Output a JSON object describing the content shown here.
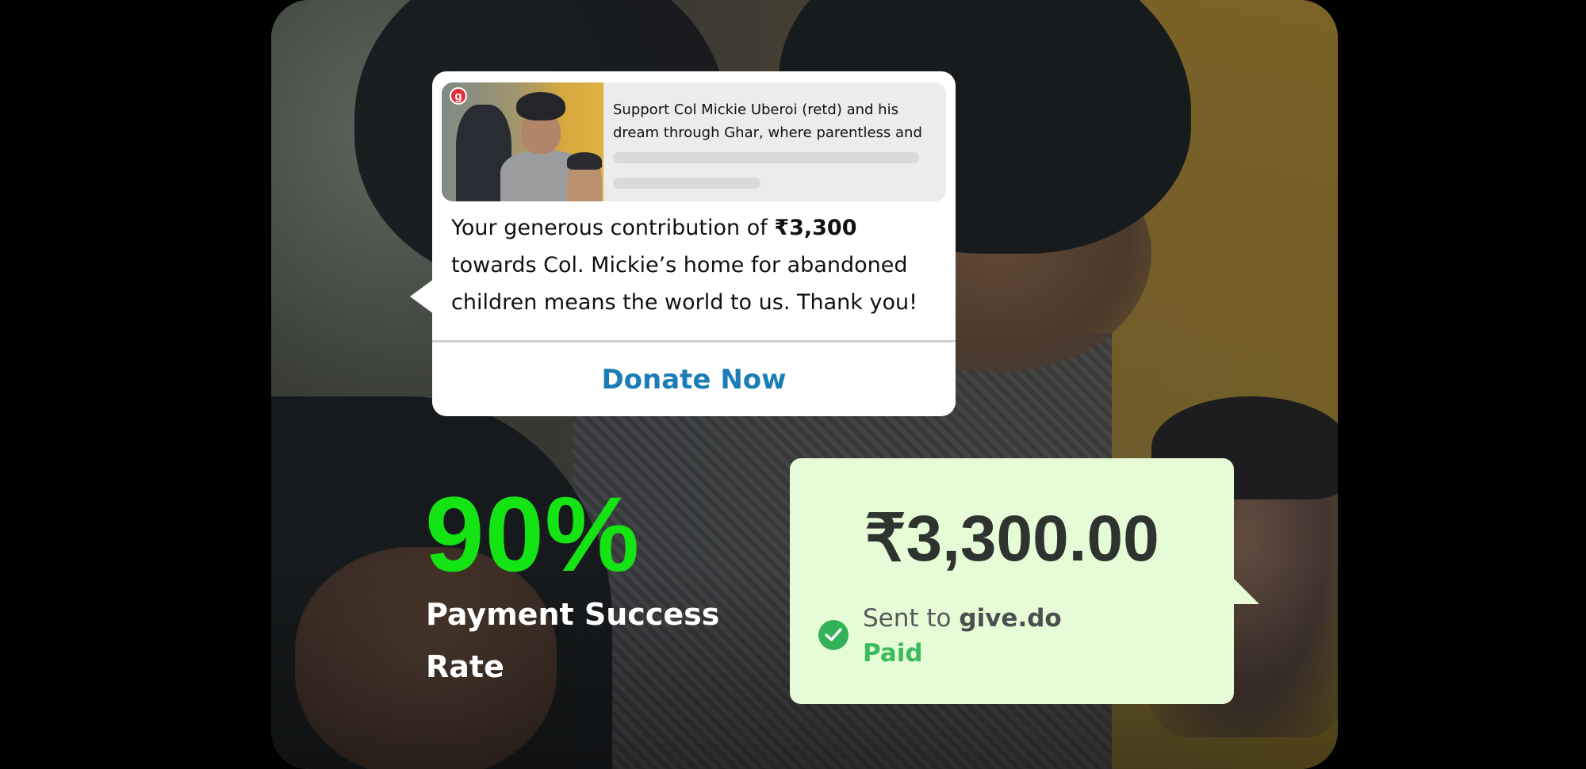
{
  "notification": {
    "badge_letter": "g",
    "preview_title": "Support Col Mickie Uberoi (retd) and his\ndream through Ghar, where parentless and",
    "message_prefix": "Your generous contribution of ",
    "message_amount": "₹3,300",
    "message_suffix": " towards Col. Mickie’s home for abandoned children means the world to us. Thank you!",
    "cta_label": "Donate Now"
  },
  "stat": {
    "value": "90%",
    "label": "Payment Success Rate"
  },
  "payment": {
    "amount": "₹3,300.00",
    "sent_prefix": "Sent to ",
    "recipient": "give.do",
    "status": "Paid"
  },
  "colors": {
    "stat_green": "#14e314",
    "cta_blue": "#1b7db5",
    "pay_bg": "#e6fcd6",
    "paid_green": "#3cbb5c",
    "badge_red": "#e3303b"
  }
}
